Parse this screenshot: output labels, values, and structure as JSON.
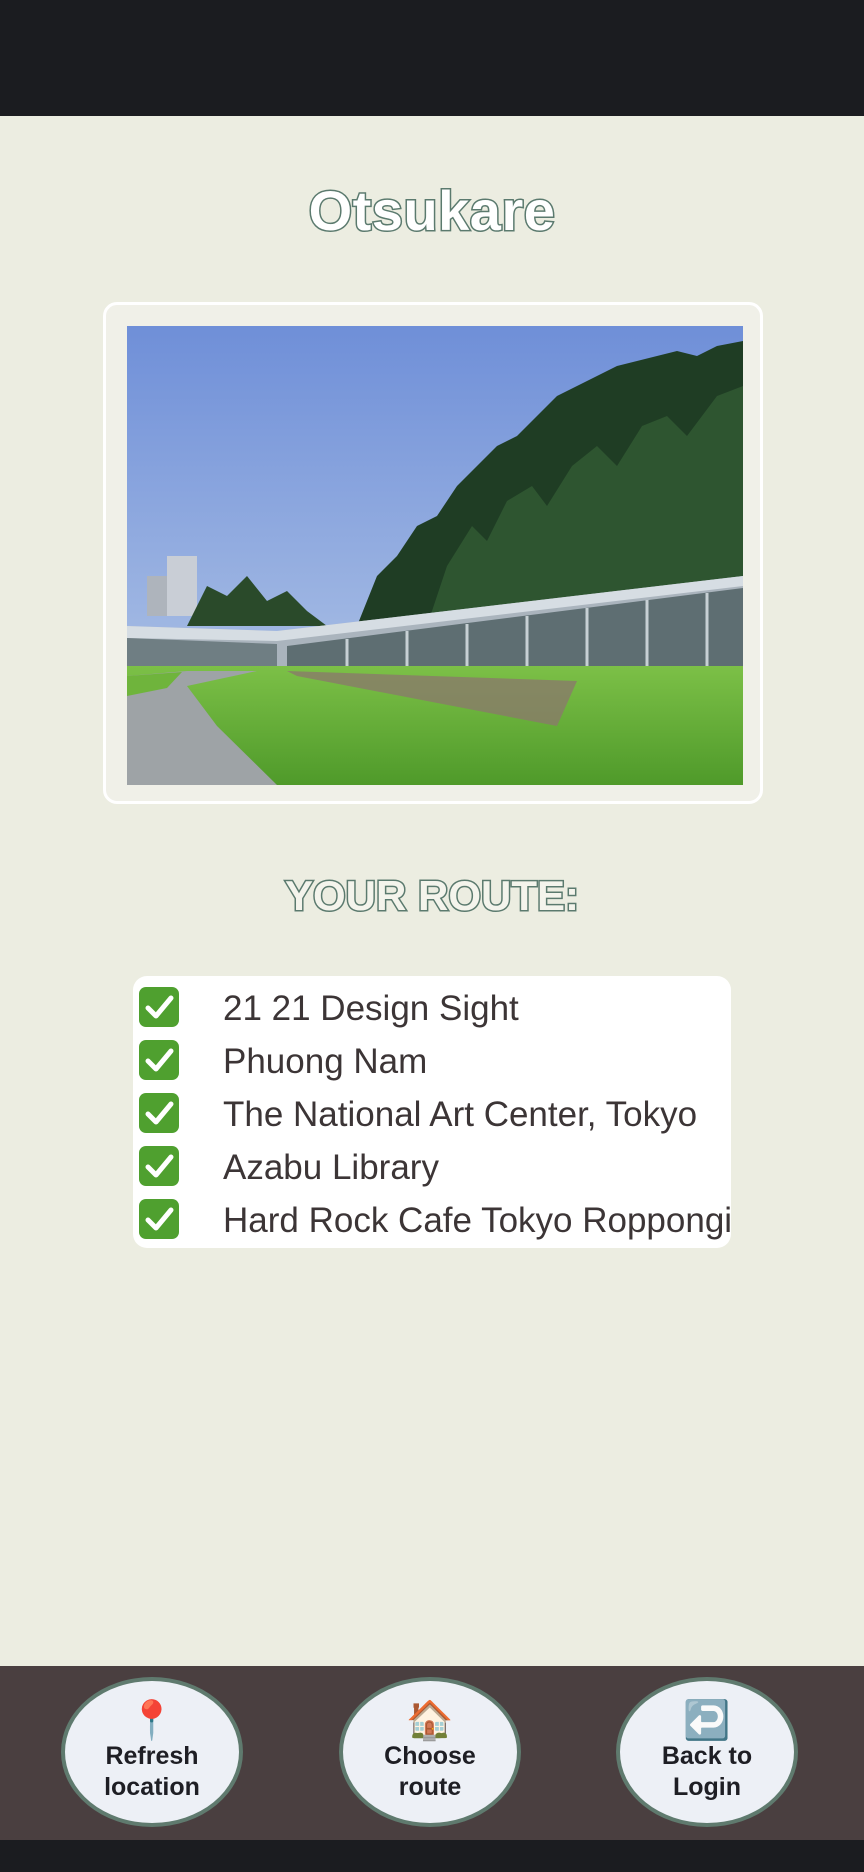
{
  "header": {
    "title": "Otsukare"
  },
  "route": {
    "heading": "YOUR ROUTE:",
    "items": [
      {
        "label": "21 21 Design Sight",
        "done": true
      },
      {
        "label": "Phuong Nam",
        "done": true
      },
      {
        "label": "The National Art Center, Tokyo",
        "done": true
      },
      {
        "label": "Azabu Library",
        "done": true
      },
      {
        "label": "Hard Rock Cafe Tokyo Roppongi",
        "done": true
      }
    ]
  },
  "nav": {
    "refresh": {
      "icon": "📍",
      "label": "Refresh\nlocation"
    },
    "choose": {
      "icon": "🏠",
      "label": "Choose\nroute"
    },
    "back": {
      "icon": "↩️",
      "label": "Back to\nLogin"
    }
  },
  "icons": {
    "check": "check-mark-icon",
    "pin": "location-pin-icon",
    "house": "house-icon",
    "back": "return-arrow-icon"
  },
  "colors": {
    "background": "#ecede1",
    "accent": "#5b7a6e",
    "nav_bar": "#4a3f40",
    "check": "#4fa02f"
  }
}
